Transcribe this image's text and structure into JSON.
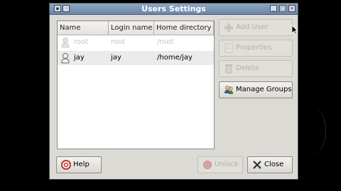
{
  "window": {
    "title": "Users Settings"
  },
  "table": {
    "columns": [
      "Name",
      "Login name",
      "Home directory"
    ],
    "rows": [
      {
        "name": "root",
        "login": "root",
        "home": "/root",
        "disabled": true
      },
      {
        "name": "jay",
        "login": "jay",
        "home": "/home/jay",
        "disabled": false
      }
    ]
  },
  "buttons": {
    "add_user": "Add User",
    "properties": "Properties",
    "delete": "Delete",
    "manage_groups": "Manage Groups",
    "help": "Help",
    "unlock": "Unlock",
    "close": "Close"
  },
  "icons": {
    "window_menu": "window-menu-icon",
    "minimize": "minimize-icon",
    "maximize": "maximize-icon",
    "close": "close-icon"
  }
}
